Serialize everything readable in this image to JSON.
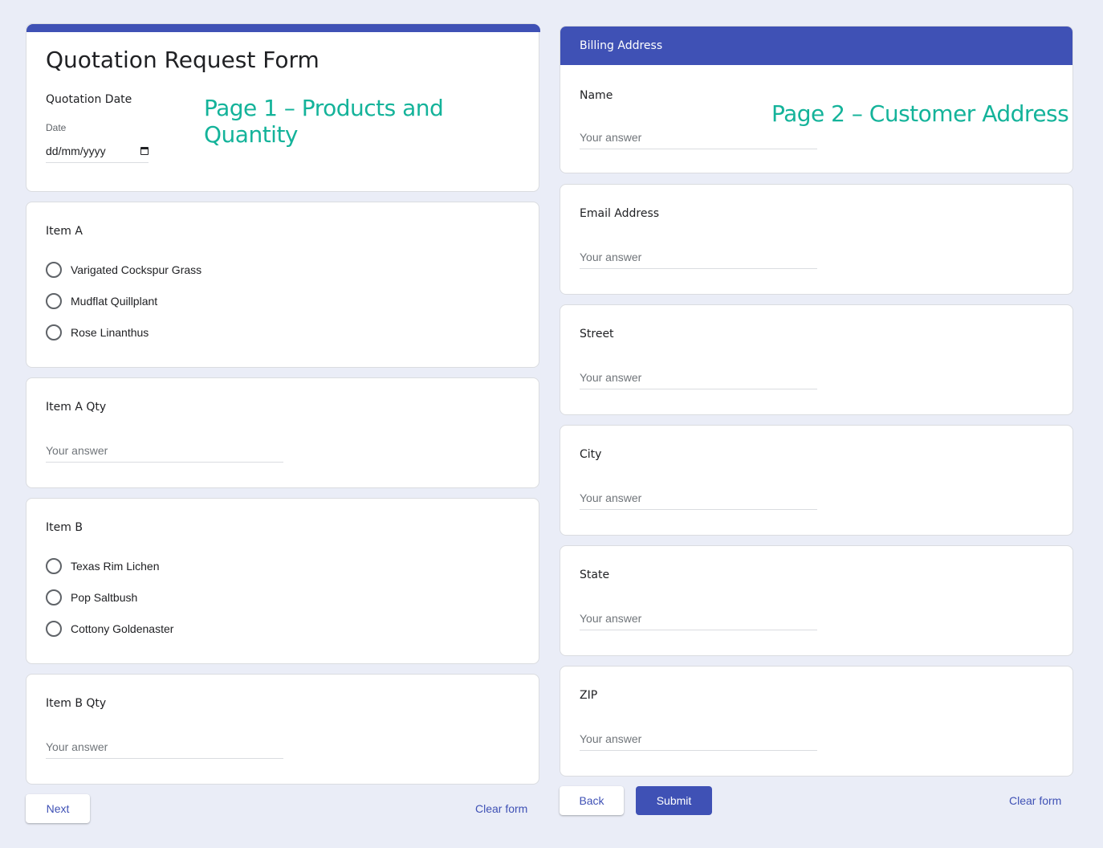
{
  "colors": {
    "accent": "#3f51b5",
    "annotation": "#14b39a",
    "background": "#eaedf7"
  },
  "page1": {
    "annotation": "Page 1 – Products and Quantity",
    "title": "Quotation Request Form",
    "date_question": {
      "label": "Quotation Date",
      "sublabel": "Date",
      "placeholder": "dd/mm/yyyy",
      "icon": "calendar-icon"
    },
    "item_a": {
      "label": "Item A",
      "options": [
        "Varigated Cockspur Grass",
        "Mudflat Quillplant",
        "Rose Linanthus"
      ]
    },
    "item_a_qty": {
      "label": "Item A Qty",
      "placeholder": "Your answer"
    },
    "item_b": {
      "label": "Item B",
      "options": [
        "Texas Rim Lichen",
        "Pop Saltbush",
        "Cottony Goldenaster"
      ]
    },
    "item_b_qty": {
      "label": "Item B Qty",
      "placeholder": "Your answer"
    },
    "next_label": "Next",
    "clear_label": "Clear form"
  },
  "page2": {
    "annotation": "Page 2 – Customer Address",
    "section_title": "Billing Address",
    "fields": [
      {
        "label": "Name",
        "placeholder": "Your answer"
      },
      {
        "label": "Email Address",
        "placeholder": "Your answer"
      },
      {
        "label": "Street",
        "placeholder": "Your answer"
      },
      {
        "label": "City",
        "placeholder": "Your answer"
      },
      {
        "label": "State",
        "placeholder": "Your answer"
      },
      {
        "label": "ZIP",
        "placeholder": "Your answer"
      }
    ],
    "back_label": "Back",
    "submit_label": "Submit",
    "clear_label": "Clear form"
  }
}
